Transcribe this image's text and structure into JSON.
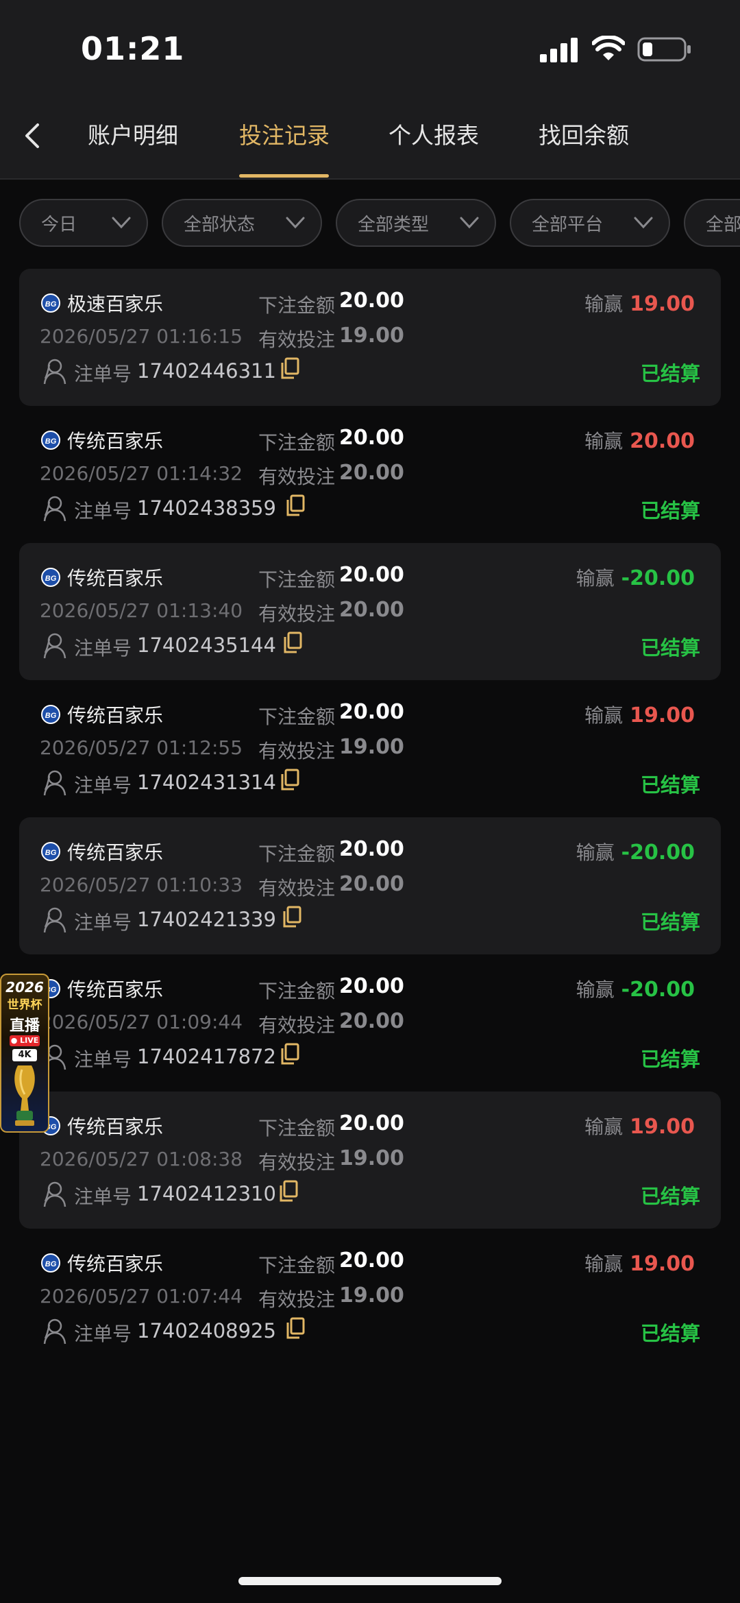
{
  "status_bar": {
    "time": "01:21"
  },
  "header": {
    "tabs": [
      {
        "label": "账户明细",
        "active": false
      },
      {
        "label": "投注记录",
        "active": true
      },
      {
        "label": "个人报表",
        "active": false
      },
      {
        "label": "找回余额",
        "active": false
      }
    ]
  },
  "filters": [
    {
      "label": "今日"
    },
    {
      "label": "全部状态"
    },
    {
      "label": "全部类型"
    },
    {
      "label": "全部平台"
    },
    {
      "label": "全部"
    }
  ],
  "labels": {
    "bet_amount": "下注金额",
    "valid_bet": "有效投注",
    "win_loss": "输赢",
    "order_no": "注单号"
  },
  "records": [
    {
      "game": "极速百家乐",
      "bet_amount": "20.00",
      "win_loss": "19.00",
      "time": "2026/05/27 01:16:15",
      "valid_bet": "19.00",
      "order_no": "17402446311",
      "status": "已结算"
    },
    {
      "game": "传统百家乐",
      "bet_amount": "20.00",
      "win_loss": "20.00",
      "time": "2026/05/27 01:14:32",
      "valid_bet": "20.00",
      "order_no": "17402438359",
      "status": "已结算"
    },
    {
      "game": "传统百家乐",
      "bet_amount": "20.00",
      "win_loss": "-20.00",
      "time": "2026/05/27 01:13:40",
      "valid_bet": "20.00",
      "order_no": "17402435144",
      "status": "已结算"
    },
    {
      "game": "传统百家乐",
      "bet_amount": "20.00",
      "win_loss": "19.00",
      "time": "2026/05/27 01:12:55",
      "valid_bet": "19.00",
      "order_no": "17402431314",
      "status": "已结算"
    },
    {
      "game": "传统百家乐",
      "bet_amount": "20.00",
      "win_loss": "-20.00",
      "time": "2026/05/27 01:10:33",
      "valid_bet": "20.00",
      "order_no": "17402421339",
      "status": "已结算"
    },
    {
      "game": "传统百家乐",
      "bet_amount": "20.00",
      "win_loss": "-20.00",
      "time": "2026/05/27 01:09:44",
      "valid_bet": "20.00",
      "order_no": "17402417872",
      "status": "已结算"
    },
    {
      "game": "传统百家乐",
      "bet_amount": "20.00",
      "win_loss": "19.00",
      "time": "2026/05/27 01:08:38",
      "valid_bet": "19.00",
      "order_no": "17402412310",
      "status": "已结算"
    },
    {
      "game": "传统百家乐",
      "bet_amount": "20.00",
      "win_loss": "19.00",
      "time": "2026/05/27 01:07:44",
      "valid_bet": "19.00",
      "order_no": "17402408925",
      "status": "已结算"
    }
  ],
  "promo": {
    "year": "2026",
    "title": "世界杯",
    "title2": "直播",
    "live": "● LIVE",
    "quality": "4K"
  },
  "colors": {
    "accent": "#e2b765",
    "positive": "#e8574f",
    "negative": "#27c245",
    "settled": "#27c245"
  }
}
